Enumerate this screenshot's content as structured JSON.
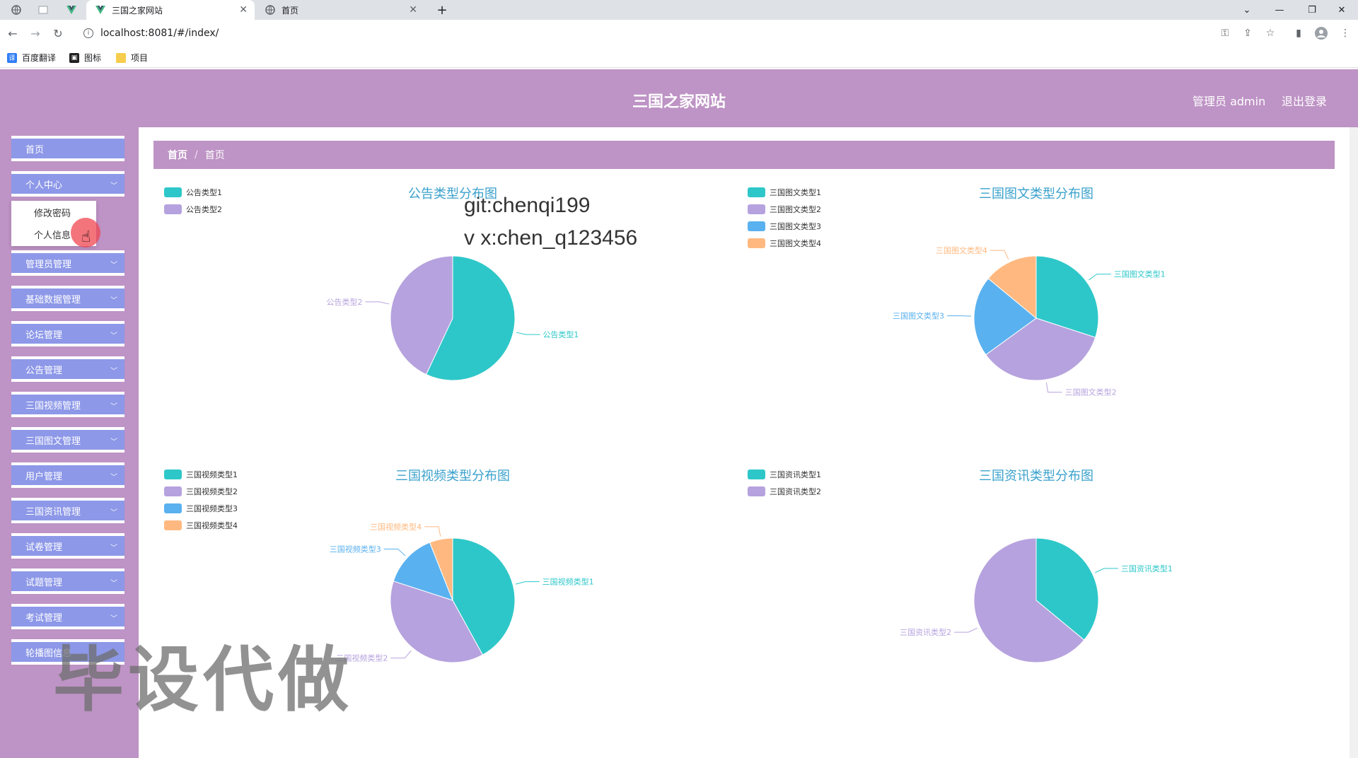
{
  "browser": {
    "tabs": [
      {
        "title": "三国之家网站",
        "active": true
      },
      {
        "title": "首页",
        "active": false
      }
    ],
    "url": "localhost:8081/#/index/",
    "bookmarks": [
      "百度翻译",
      "图标",
      "项目"
    ]
  },
  "header": {
    "title": "三国之家网站",
    "user_label": "管理员 admin",
    "logout_label": "退出登录"
  },
  "sidebar": {
    "items": [
      {
        "label": "首页",
        "has_arrow": false
      },
      {
        "label": "个人中心",
        "has_arrow": true
      },
      {
        "label": "管理员管理",
        "has_arrow": true
      },
      {
        "label": "基础数据管理",
        "has_arrow": true
      },
      {
        "label": "论坛管理",
        "has_arrow": true
      },
      {
        "label": "公告管理",
        "has_arrow": true
      },
      {
        "label": "三国视频管理",
        "has_arrow": true
      },
      {
        "label": "三国图文管理",
        "has_arrow": true
      },
      {
        "label": "用户管理",
        "has_arrow": true
      },
      {
        "label": "三国资讯管理",
        "has_arrow": true
      },
      {
        "label": "试卷管理",
        "has_arrow": true
      },
      {
        "label": "试题管理",
        "has_arrow": true
      },
      {
        "label": "考试管理",
        "has_arrow": true
      },
      {
        "label": "轮播图信息",
        "has_arrow": false
      }
    ],
    "submenu": [
      "修改密码",
      "个人信息"
    ]
  },
  "breadcrumb": [
    "首页",
    "首页"
  ],
  "watermark": {
    "line1": "git:chenqi199",
    "line2": "v x:chen_q123456",
    "big": "毕设代做"
  },
  "colors": {
    "header": "#be93c5",
    "menu_item": "#8d98e8",
    "title": "#3aa1cc",
    "series": [
      "#2ec7c9",
      "#b6a2de",
      "#5ab1ef",
      "#ffb980"
    ]
  },
  "chart_data": [
    {
      "type": "pie",
      "title": "公告类型分布图",
      "categories": [
        "公告类型1",
        "公告类型2"
      ],
      "values": [
        57,
        43
      ]
    },
    {
      "type": "pie",
      "title": "三国图文类型分布图",
      "categories": [
        "三国图文类型1",
        "三国图文类型2",
        "三国图文类型3",
        "三国图文类型4"
      ],
      "values": [
        30,
        35,
        21,
        14
      ]
    },
    {
      "type": "pie",
      "title": "三国视频类型分布图",
      "categories": [
        "三国视频类型1",
        "三国视频类型2",
        "三国视频类型3",
        "三国视频类型4"
      ],
      "values": [
        42,
        38,
        14,
        6
      ]
    },
    {
      "type": "pie",
      "title": "三国资讯类型分布图",
      "categories": [
        "三国资讯类型1",
        "三国资讯类型2"
      ],
      "values": [
        36,
        64
      ]
    }
  ]
}
